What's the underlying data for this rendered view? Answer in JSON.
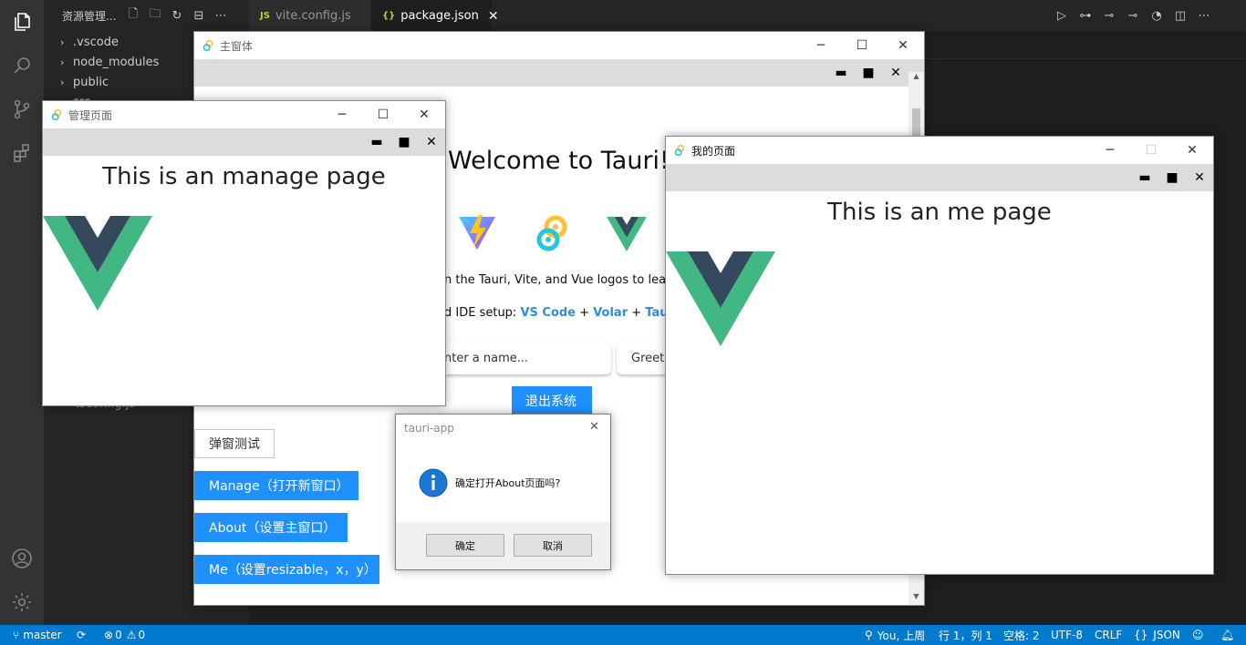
{
  "vscode": {
    "explorer_title": "资源管理...",
    "tree": [
      ".vscode",
      "node_modules",
      "public",
      "src"
    ],
    "hidden_tree_fragment": "tsconfig.js",
    "tabs": [
      {
        "icon": "JS",
        "label": "vite.config.js",
        "active": false
      },
      {
        "icon": "{}",
        "label": "package.json",
        "active": true
      }
    ],
    "status": {
      "branch": "master",
      "errors": "0",
      "warnings": "0",
      "blame": "You, 上周",
      "position": "行 1，列 1",
      "spaces": "空格: 2",
      "encoding": "UTF-8",
      "eol": "CRLF",
      "language": "JSON"
    },
    "colors": {
      "statusbar": "#007acc",
      "activitybar": "#333333",
      "sidebar": "#252526",
      "editor": "#1e1e1e"
    }
  },
  "main_window": {
    "title": "主窗体",
    "heading": "Welcome to Tauri!",
    "hint": "n the Tauri, Vite, and Vue logos to learn",
    "ide_prefix": "d IDE setup: ",
    "ide_links": [
      "VS Code",
      "Volar",
      "Tauri"
    ],
    "plus": "+",
    "name_placeholder": "nter a name...",
    "greet_label": "Greet",
    "logout_label": "退出系统",
    "popup_test_label": "弹窗测试",
    "manage_label": "Manage（打开新窗口）",
    "about_label": "About（设置主窗口）",
    "me_label": "Me（设置resizable，x，y）"
  },
  "manage_window": {
    "title": "管理页面",
    "heading": "This is an manage page"
  },
  "me_window": {
    "title": "我的页面",
    "heading": "This is an me page"
  },
  "dialog": {
    "title": "tauri-app",
    "message": "确定打开About页面吗?",
    "ok_label": "确定",
    "cancel_label": "取消"
  },
  "brand_colors": {
    "vue_green": "#41b883",
    "vue_dark": "#34495e",
    "tauri_yellow": "#ffc131",
    "tauri_blue": "#24c8db",
    "button_blue": "#1e90ff"
  }
}
